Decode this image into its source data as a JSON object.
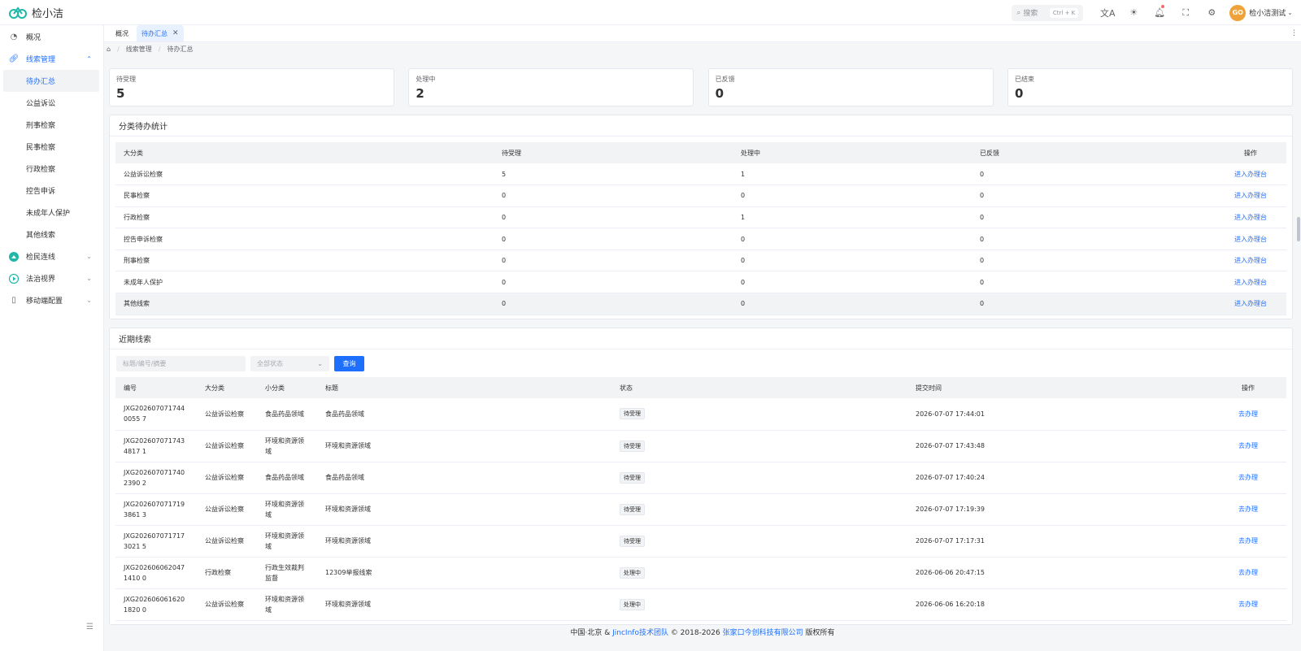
{
  "app": {
    "title": "检小洁",
    "logo_text": "GO"
  },
  "header": {
    "search_label": "搜索",
    "search_shortcut": "Ctrl + K",
    "user_name": "检小洁测试",
    "avatar_text": "GO"
  },
  "sidebar": {
    "overview": "概况",
    "clue_mgmt": "线索管理",
    "sub_items": [
      "待办汇总",
      "公益诉讼",
      "刑事检察",
      "民事检察",
      "行政检察",
      "控告申诉",
      "未成年人保护",
      "其他线索"
    ],
    "connect": "检民连线",
    "law_view": "法治视界",
    "mobile_config": "移动端配置"
  },
  "tabs": [
    "概况",
    "待办汇总"
  ],
  "breadcrumb": [
    "线索管理",
    "待办汇总"
  ],
  "stats": [
    {
      "label": "待受理",
      "value": "5"
    },
    {
      "label": "处理中",
      "value": "2"
    },
    {
      "label": "已反馈",
      "value": "0"
    },
    {
      "label": "已结束",
      "value": "0"
    }
  ],
  "category_panel": {
    "title": "分类待办统计",
    "headers": [
      "大分类",
      "待受理",
      "处理中",
      "已反馈",
      "操作"
    ],
    "rows": [
      [
        "公益诉讼检察",
        "5",
        "1",
        "0",
        "进入办理台"
      ],
      [
        "民事检察",
        "0",
        "0",
        "0",
        "进入办理台"
      ],
      [
        "行政检察",
        "0",
        "1",
        "0",
        "进入办理台"
      ],
      [
        "控告申诉检察",
        "0",
        "0",
        "0",
        "进入办理台"
      ],
      [
        "刑事检察",
        "0",
        "0",
        "0",
        "进入办理台"
      ],
      [
        "未成年人保护",
        "0",
        "0",
        "0",
        "进入办理台"
      ],
      [
        "其他线索",
        "0",
        "0",
        "0",
        "进入办理台"
      ]
    ]
  },
  "recent_panel": {
    "title": "近期线索",
    "search_placeholder": "标题/编号/摘要",
    "status_select": "全部状态",
    "query_button": "查询",
    "headers": [
      "编号",
      "大分类",
      "小分类",
      "标题",
      "状态",
      "提交时间",
      "操作"
    ],
    "rows": [
      [
        "JXG2026070717440055 7",
        "公益诉讼检察",
        "食品药品领域",
        "食品药品领域",
        "待受理",
        "2026-07-07 17:44:01",
        "去办理"
      ],
      [
        "JXG2026070717434817 1",
        "公益诉讼检察",
        "环境和资源领域",
        "环境和资源领域",
        "待受理",
        "2026-07-07 17:43:48",
        "去办理"
      ],
      [
        "JXG2026070717402390 2",
        "公益诉讼检察",
        "食品药品领域",
        "食品药品领域",
        "待受理",
        "2026-07-07 17:40:24",
        "去办理"
      ],
      [
        "JXG2026070717193861 3",
        "公益诉讼检察",
        "环境和资源领域",
        "环境和资源领域",
        "待受理",
        "2026-07-07 17:19:39",
        "去办理"
      ],
      [
        "JXG2026070717173021 5",
        "公益诉讼检察",
        "环境和资源领域",
        "环境和资源领域",
        "待受理",
        "2026-07-07 17:17:31",
        "去办理"
      ],
      [
        "JXG2026060620471410 0",
        "行政检察",
        "行政生效裁判监督",
        "12309举报线索",
        "处理中",
        "2026-06-06 20:47:15",
        "去办理"
      ],
      [
        "JXG2026060616201820 0",
        "公益诉讼检察",
        "环境和资源领域",
        "环境和资源领域",
        "处理中",
        "2026-06-06 16:20:18",
        "去办理"
      ]
    ]
  },
  "footer": {
    "prefix": "中国·北京 & ",
    "team": "JincInfo技术团队",
    "middle": " © 2018-2026 ",
    "company": "张家口今创科技有限公司",
    "suffix": " 版权所有"
  },
  "colors": {
    "accent": "#1f6fff",
    "logo": "#1fb8a8"
  }
}
